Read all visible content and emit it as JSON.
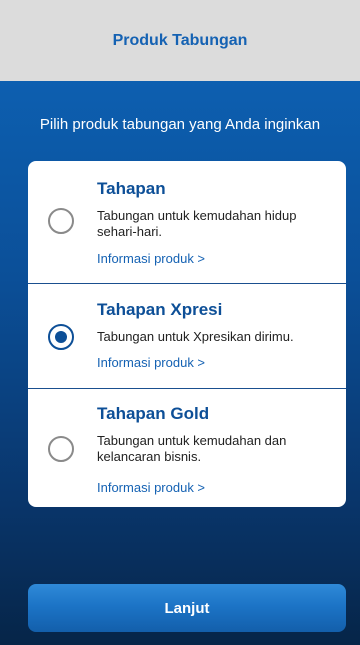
{
  "header": {
    "title": "Produk Tabungan"
  },
  "instruction": "Pilih produk tabungan yang Anda inginkan",
  "options": [
    {
      "title": "Tahapan",
      "description": "Tabungan untuk kemudahan hidup sehari-hari.",
      "link": "Informasi produk >",
      "selected": false
    },
    {
      "title": "Tahapan Xpresi",
      "description": "Tabungan untuk Xpresikan dirimu.",
      "link": "Informasi produk >",
      "selected": true
    },
    {
      "title": "Tahapan Gold",
      "description": "Tabungan untuk kemudahan dan kelancaran bisnis.",
      "link": "Informasi produk >",
      "selected": false
    }
  ],
  "cta": {
    "label": "Lanjut"
  },
  "colors": {
    "accent": "#0d4f97",
    "header_bg": "#dcdcdc",
    "link": "#1562b3"
  }
}
